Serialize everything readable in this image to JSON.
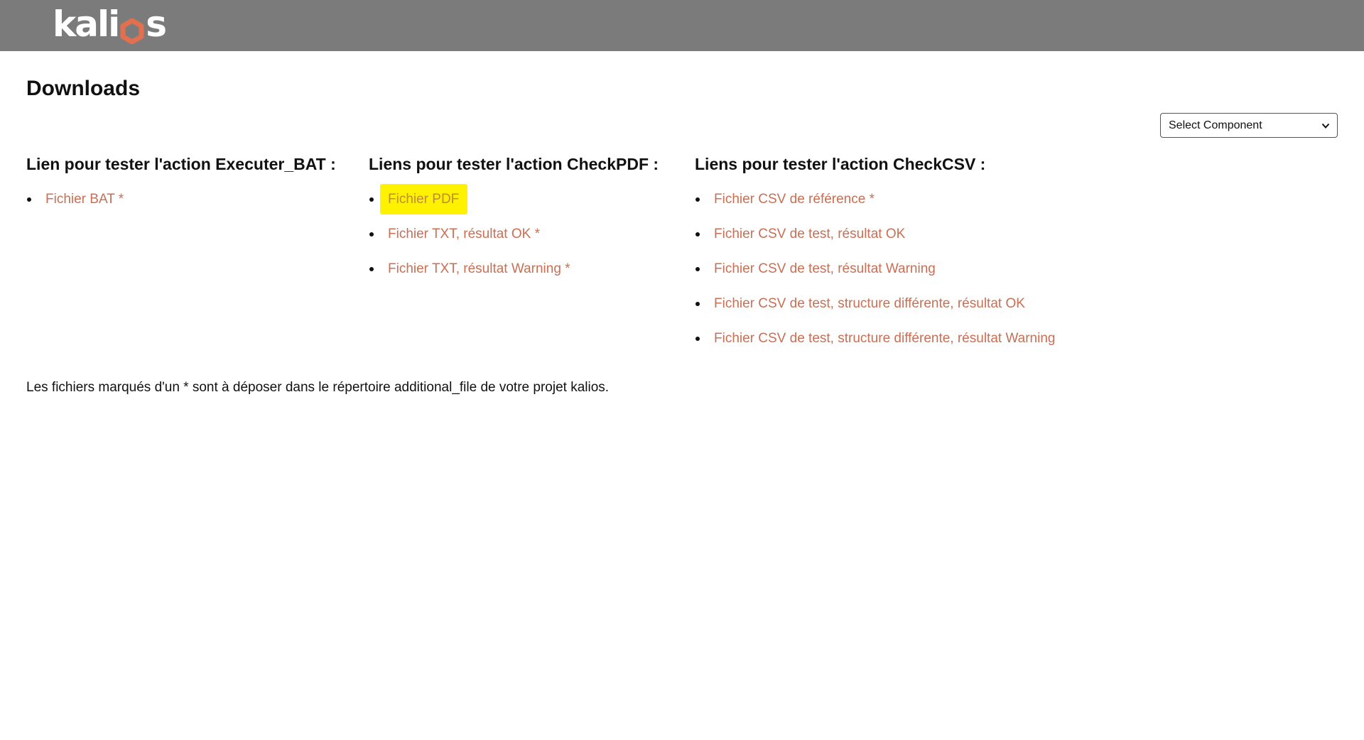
{
  "header": {
    "logo_text_left": "kali",
    "logo_text_right": "s",
    "logo_accent_color": "#e2704f",
    "background_color": "#7b7b7b"
  },
  "page": {
    "title": "Downloads"
  },
  "component_select": {
    "selected": "Select Component"
  },
  "sections": [
    {
      "heading": "Lien pour tester l'action Executer_BAT :",
      "links": [
        {
          "label": "Fichier BAT *"
        }
      ]
    },
    {
      "heading": "Liens pour tester l'action CheckPDF :",
      "links": [
        {
          "label": "Fichier PDF"
        },
        {
          "label": "Fichier TXT, résultat OK *"
        },
        {
          "label": "Fichier TXT, résultat Warning *"
        }
      ]
    },
    {
      "heading": "Liens pour tester l'action CheckCSV :",
      "links": [
        {
          "label": "Fichier CSV de référence *"
        },
        {
          "label": "Fichier CSV de test, résultat OK"
        },
        {
          "label": "Fichier CSV de test, résultat Warning"
        },
        {
          "label": "Fichier CSV de test, structure différente, résultat OK"
        },
        {
          "label": "Fichier CSV de test, structure différente, résultat Warning"
        }
      ]
    }
  ],
  "footnote": "Les fichiers marqués d'un * sont à déposer dans le répertoire additional_file de votre projet kalios.",
  "colors": {
    "link": "#c86f55",
    "highlight": "#fff200"
  },
  "icons": {
    "logo_o": "hexagon-icon",
    "select_arrow": "chevron-down-icon"
  }
}
